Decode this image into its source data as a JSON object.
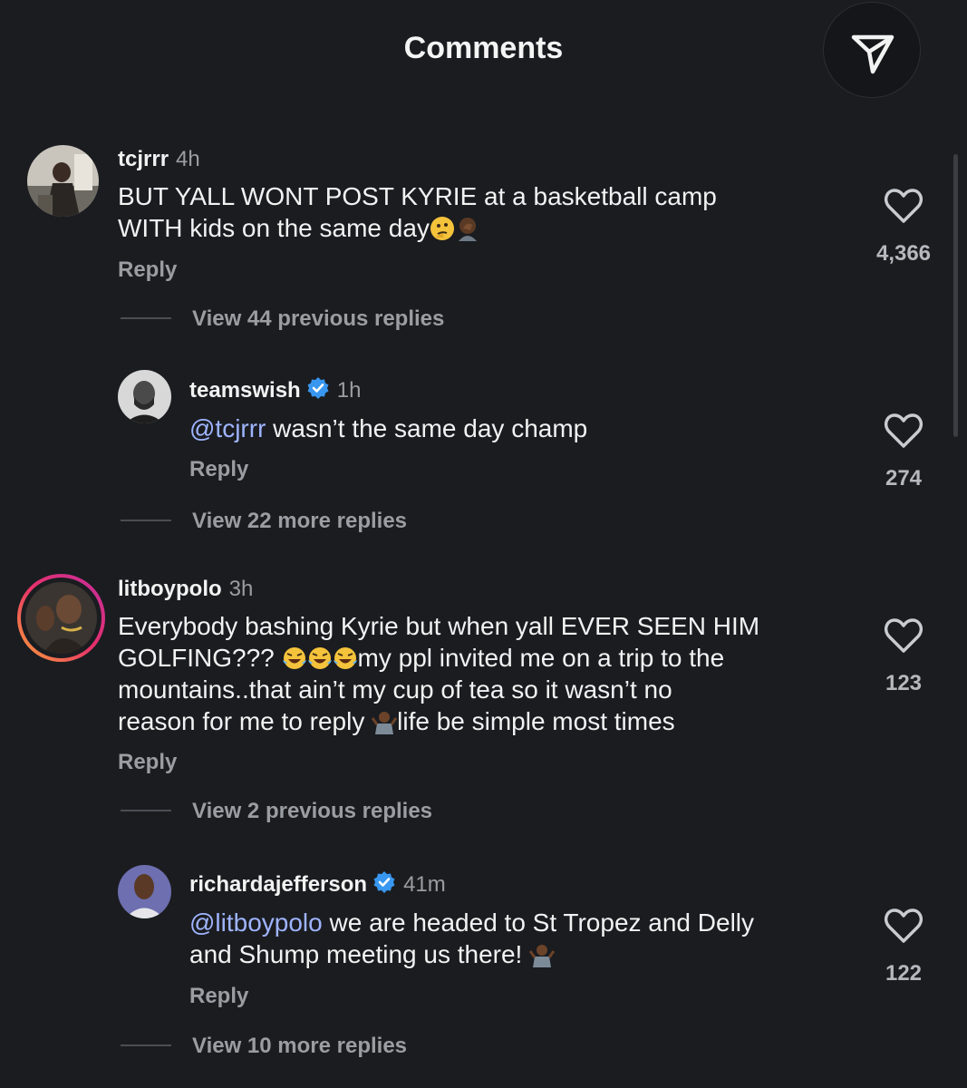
{
  "header": {
    "title": "Comments",
    "share_icon": "send-icon"
  },
  "comments": [
    {
      "username": "tcjrrr",
      "time": "4h",
      "text_line1": "BUT YALL WONT POST KYRIE  at a basketball camp",
      "text_line2": "WITH kids on the same day",
      "likes": "4,366",
      "reply": "Reply",
      "view_replies": "View 44 previous replies"
    },
    {
      "username": "teamswish",
      "time": "1h",
      "mention": "@tcjrrr",
      "text": " wasn’t the same day champ",
      "likes": "274",
      "reply": "Reply",
      "view_replies": "View 22 more replies"
    },
    {
      "username": "litboypolo",
      "time": "3h",
      "text_line1": "Everybody bashing Kyrie but when yall EVER SEEN HIM",
      "text_line2a": "GOLFING??? ",
      "text_line2b": "my ppl invited me on a trip to the",
      "text_line3": "mountains..that ain’t my cup of tea so it wasn’t no",
      "text_line4a": "reason for me to reply ",
      "text_line4b": "life be simple most times",
      "likes": "123",
      "reply": "Reply",
      "view_replies": "View 2 previous replies"
    },
    {
      "username": "richardajefferson",
      "time": "41m",
      "mention": "@litboypolo",
      "text_line1": " we are headed to St Tropez and Delly",
      "text_line2": "and Shump meeting us there! ",
      "likes": "122",
      "reply": "Reply",
      "view_replies": "View 10 more replies"
    }
  ],
  "colors": {
    "background": "#1a1c20",
    "mention": "#9fb4ff",
    "verified": "#3897f0",
    "story_ring": "#d6249f"
  }
}
